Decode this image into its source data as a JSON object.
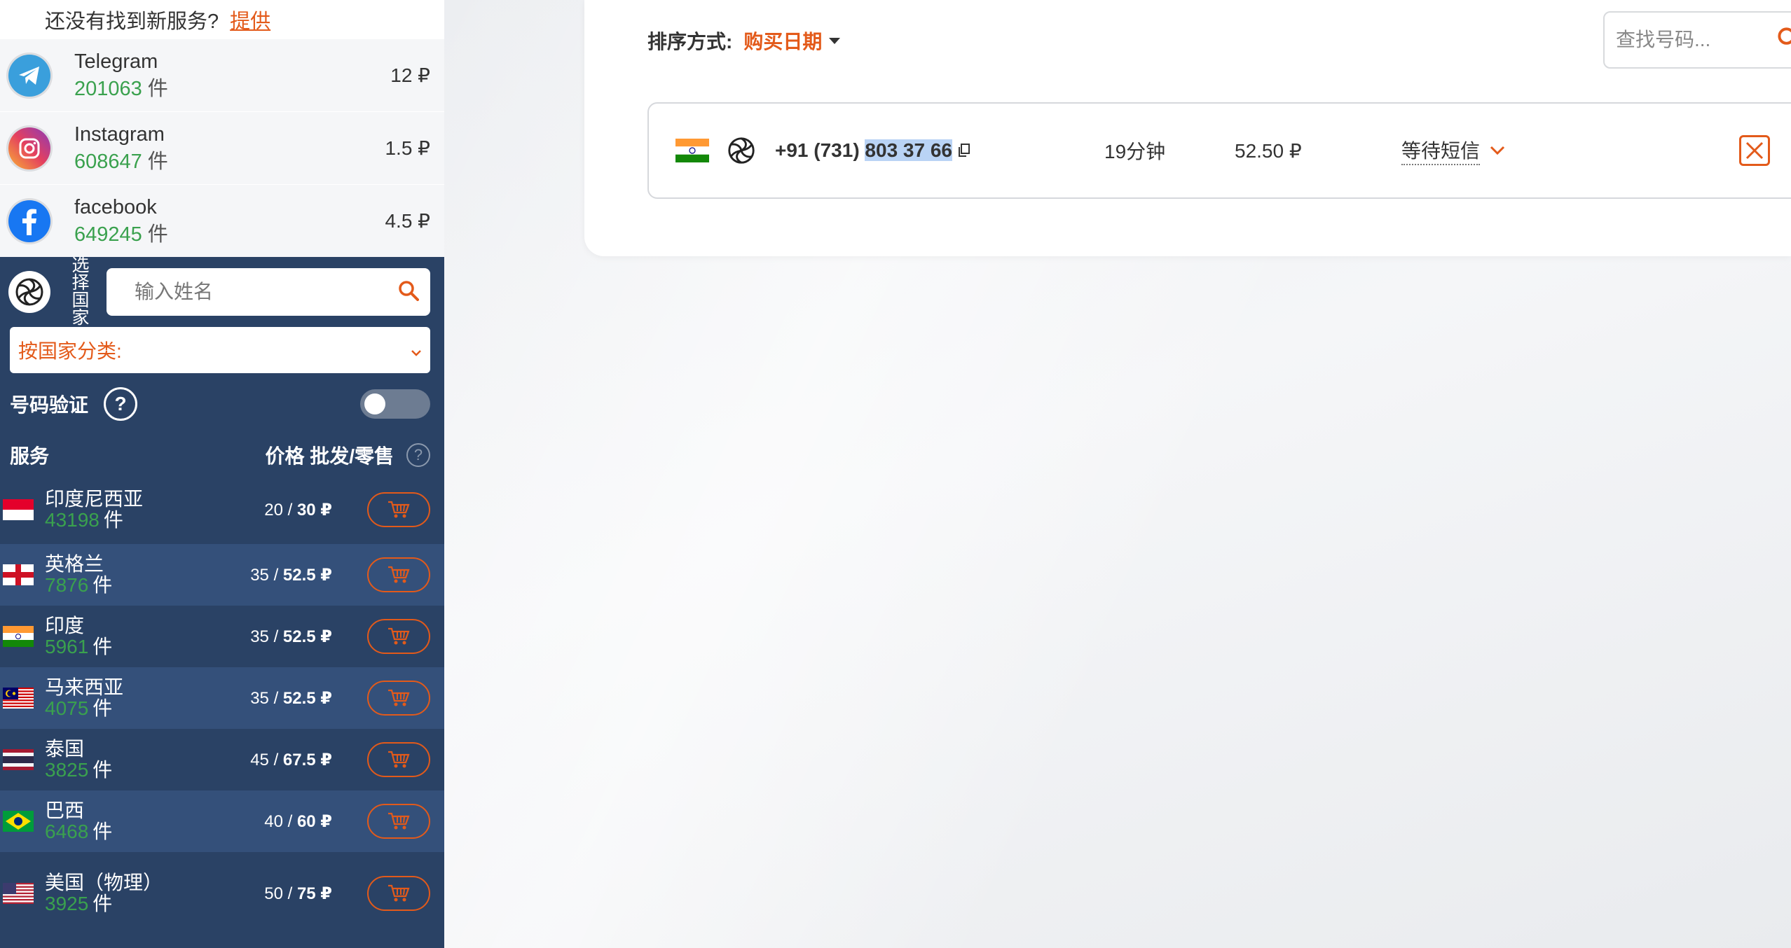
{
  "sidebar": {
    "suggest": {
      "text": "还没有找到新服务?",
      "link": "提供"
    },
    "services": [
      {
        "name": "Telegram",
        "count": "201063",
        "unit": "件",
        "price": "12 ₽",
        "icon": "telegram-icon"
      },
      {
        "name": "Instagram",
        "count": "608647",
        "unit": "件",
        "price": "1.5 ₽",
        "icon": "instagram-icon"
      },
      {
        "name": "facebook",
        "count": "649245",
        "unit": "件",
        "price": "4.5 ₽",
        "icon": "facebook-icon"
      }
    ],
    "select_country_label": "选择国家",
    "name_search_placeholder": "输入姓名",
    "country_filter": "按国家分类:",
    "verify_label": "号码验证",
    "verify_help": "?",
    "list_header": {
      "service": "服务",
      "price": "价格 批发/零售",
      "help": "?"
    },
    "countries": [
      {
        "name": "印度尼西亚",
        "count": "43198",
        "unit": "件",
        "wholesale": "20",
        "retail": "30 ₽",
        "flag": "indonesia"
      },
      {
        "name": "英格兰",
        "count": "7876",
        "unit": "件",
        "wholesale": "35",
        "retail": "52.5 ₽",
        "flag": "england"
      },
      {
        "name": "印度",
        "count": "5961",
        "unit": "件",
        "wholesale": "35",
        "retail": "52.5 ₽",
        "flag": "india"
      },
      {
        "name": "马来西亚",
        "count": "4075",
        "unit": "件",
        "wholesale": "35",
        "retail": "52.5 ₽",
        "flag": "malaysia"
      },
      {
        "name": "泰国",
        "count": "3825",
        "unit": "件",
        "wholesale": "45",
        "retail": "67.5 ₽",
        "flag": "thailand"
      },
      {
        "name": "巴西",
        "count": "6468",
        "unit": "件",
        "wholesale": "40",
        "retail": "60 ₽",
        "flag": "brazil"
      },
      {
        "name": "美国（物理）",
        "count": "3925",
        "unit": "件",
        "wholesale": "50",
        "retail": "75 ₽",
        "flag": "usa"
      }
    ]
  },
  "main": {
    "sort_label": "排序方式:",
    "sort_value": "购买日期",
    "search_placeholder": "查找号码...",
    "order": {
      "phone_prefix": "+91 (731) ",
      "phone_selected": "803 37 66",
      "time": "19分钟",
      "price": "52.50 ₽",
      "status": "等待短信"
    }
  },
  "colors": {
    "accent": "#e35a1a",
    "sidebar": "#2a4265",
    "green": "#3aa14e"
  }
}
